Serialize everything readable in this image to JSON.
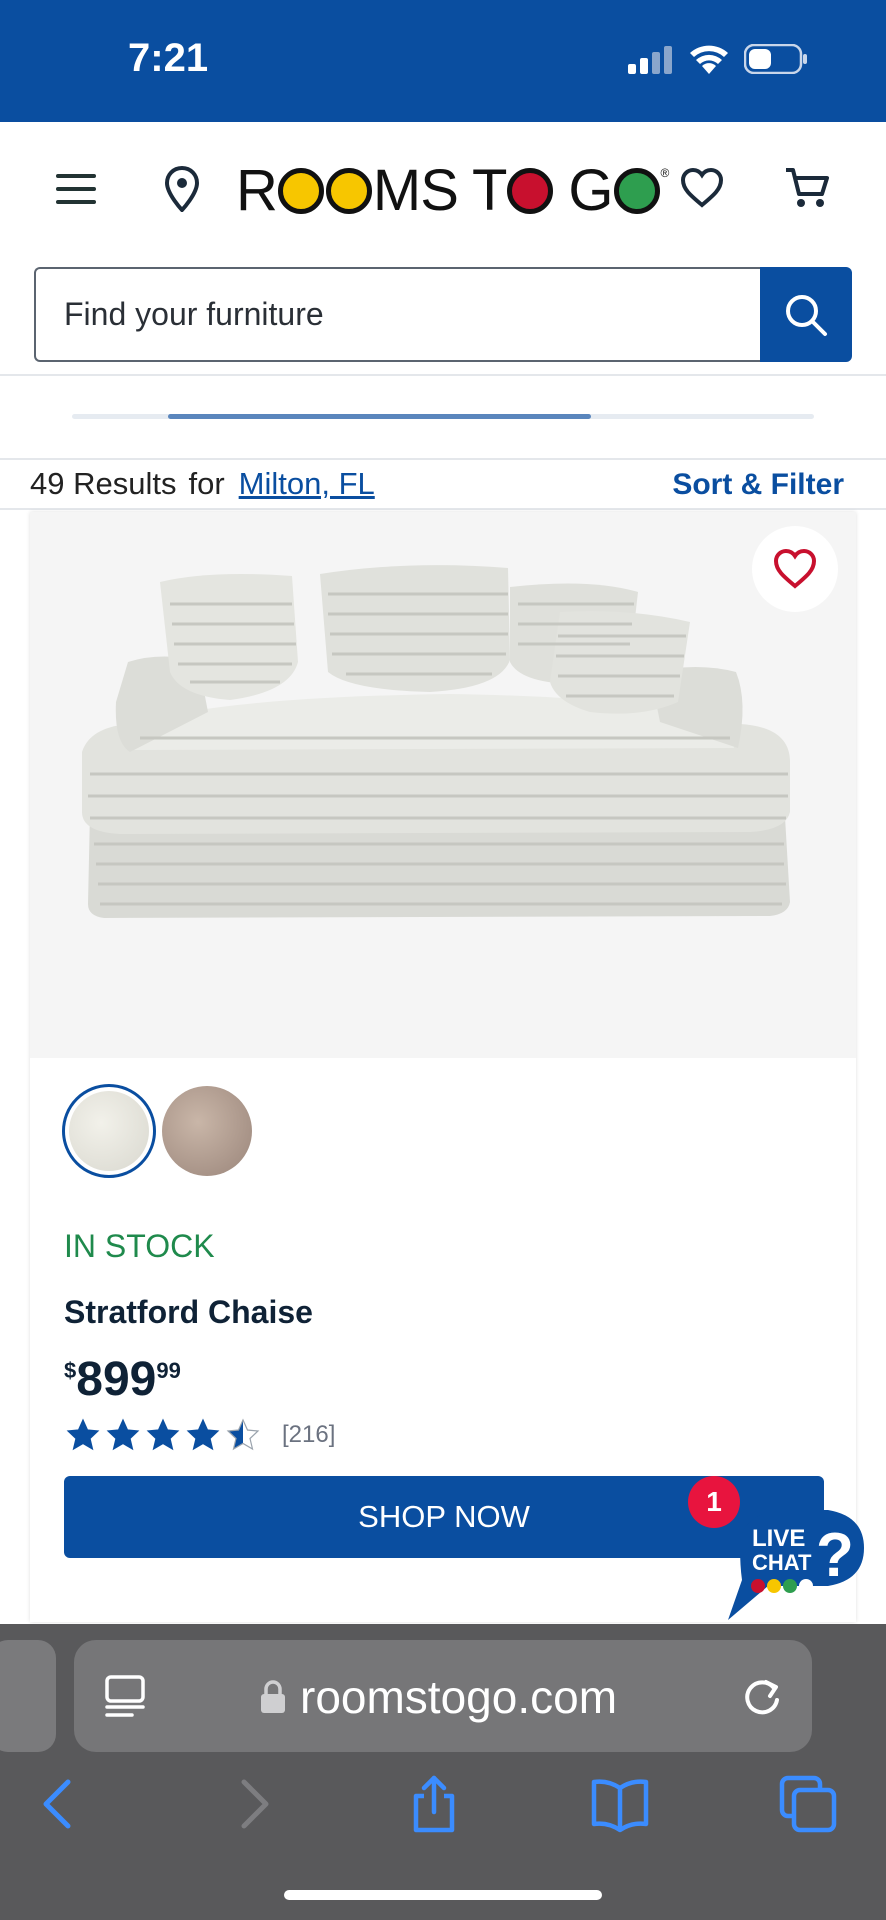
{
  "status_bar": {
    "time": "7:21"
  },
  "header": {
    "brand": {
      "word1": "R",
      "word1b": "MS T",
      "word1c": "G",
      "trademark": "®"
    },
    "search": {
      "placeholder": "Find your furniture"
    }
  },
  "carousel": {
    "progress_start": 0.13,
    "progress_end": 0.7
  },
  "results": {
    "count_text": "49 Results",
    "for_text": "for",
    "location": "Milton, FL",
    "sort_filter_label": "Sort & Filter"
  },
  "product": {
    "stock_status": "IN STOCK",
    "name": "Stratford Chaise",
    "price": {
      "currency": "$",
      "dollars": "899",
      "cents": "99"
    },
    "rating": {
      "stars": 4.5,
      "count": "[216]"
    },
    "cta_label": "SHOP NOW",
    "swatches": [
      "cream",
      "taupe"
    ]
  },
  "live_chat": {
    "badge": "1",
    "line1": "LIVE",
    "line2": "CHAT",
    "mark": "?"
  },
  "browser": {
    "url": "roomstogo.com"
  },
  "colors": {
    "brand_blue": "#0a4ea0",
    "stock_green": "#1f8a4c",
    "badge_red": "#e8143e"
  }
}
